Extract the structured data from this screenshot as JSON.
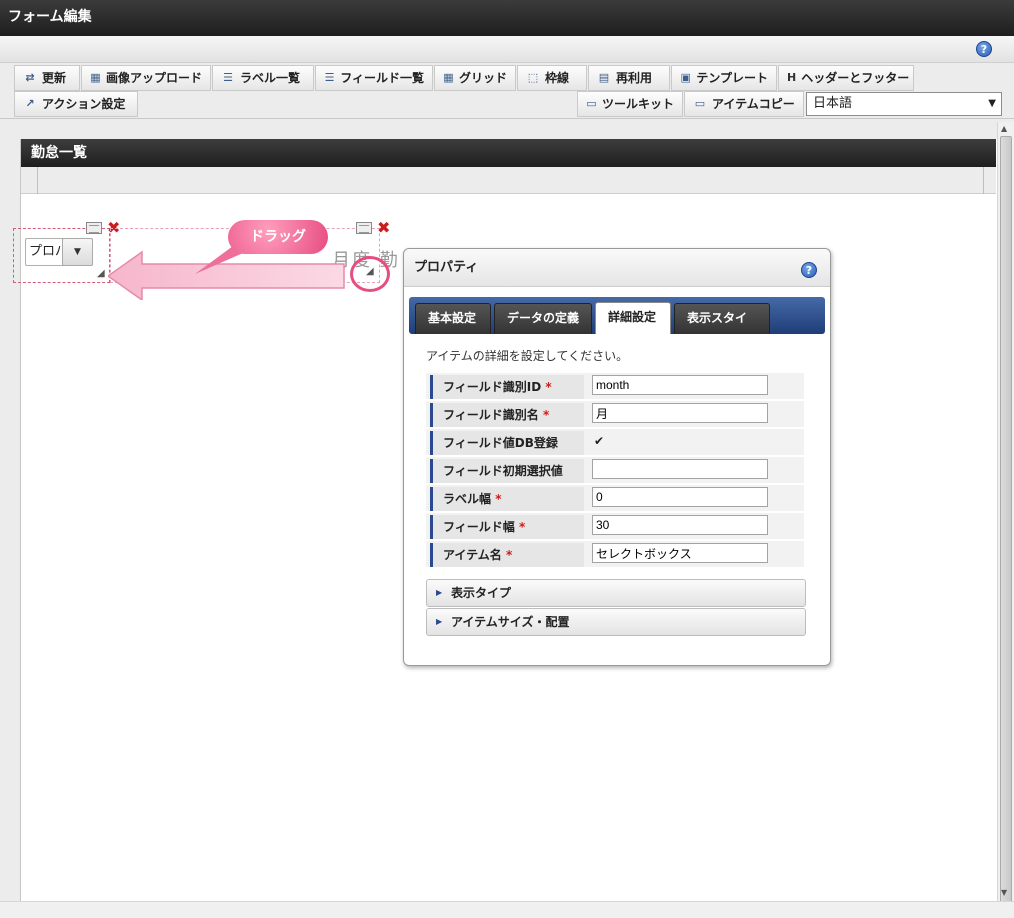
{
  "window": {
    "title": "フォーム編集"
  },
  "toolbar": {
    "row1": [
      {
        "label": "更新",
        "icon": "refresh-icon"
      },
      {
        "label": "画像アップロード",
        "icon": "image-upload-icon"
      },
      {
        "label": "ラベル一覧",
        "icon": "list-icon"
      },
      {
        "label": "フィールド一覧",
        "icon": "list-icon"
      },
      {
        "label": "グリッド",
        "icon": "grid-icon"
      },
      {
        "label": "枠線",
        "icon": "border-icon"
      },
      {
        "label": "再利用",
        "icon": "document-icon"
      },
      {
        "label": "テンプレート",
        "icon": "template-icon"
      },
      {
        "label": "ヘッダーとフッター",
        "icon": "header-icon"
      }
    ],
    "row2": [
      {
        "label": "アクション設定",
        "icon": "action-icon"
      },
      {
        "label": "ツールキット",
        "icon": "toolbox-icon"
      },
      {
        "label": "アイテムコピー",
        "icon": "copy-icon"
      }
    ],
    "language": "日本語"
  },
  "form": {
    "section_title": "勤怠一覧",
    "select_value": "プロパ",
    "faded_label": "月度 勤",
    "drag_bubble": "ドラッグ"
  },
  "properties": {
    "title": "プロパティ",
    "tabs": [
      "基本設定",
      "データの定義",
      "詳細設定",
      "表示スタイル"
    ],
    "active_tab": "詳細設定",
    "description": "アイテムの詳細を設定してください。",
    "rows": [
      {
        "label": "フィールド識別ID",
        "required": true,
        "value": "month"
      },
      {
        "label": "フィールド識別名",
        "required": true,
        "value": "月"
      },
      {
        "label": "フィールド値DB登録",
        "required": false,
        "value": "✔"
      },
      {
        "label": "フィールド初期選択値",
        "required": false,
        "value": ""
      },
      {
        "label": "ラベル幅",
        "required": true,
        "value": "0"
      },
      {
        "label": "フィールド幅",
        "required": true,
        "value": "30"
      },
      {
        "label": "アイテム名",
        "required": true,
        "value": "セレクトボックス"
      }
    ],
    "sections": [
      "表示タイプ",
      "アイテムサイズ・配置"
    ]
  },
  "colors": {
    "accent": "#e74c82",
    "tab_bar": "#2a4a8f",
    "header": "#2b2b2b"
  }
}
